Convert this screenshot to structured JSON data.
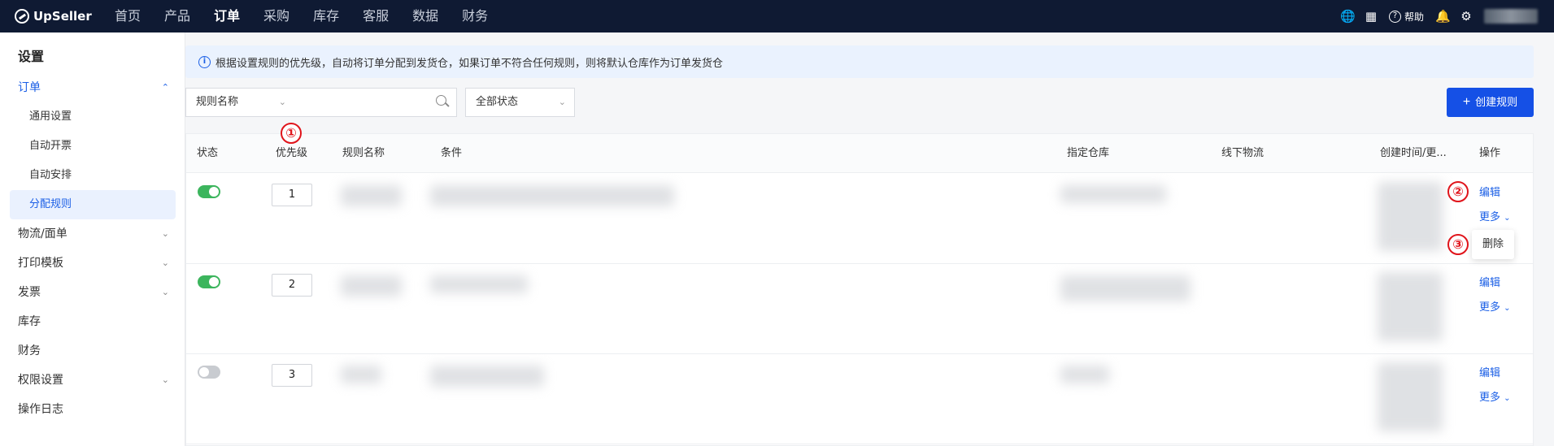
{
  "topbar": {
    "logo": "UpSeller",
    "nav": [
      "首页",
      "产品",
      "订单",
      "采购",
      "库存",
      "客服",
      "数据",
      "财务"
    ],
    "active_nav": "订单",
    "help": "帮助"
  },
  "sidebar": {
    "title": "设置",
    "items": [
      {
        "label": "订单",
        "expanded": true
      },
      {
        "label": "通用设置"
      },
      {
        "label": "自动开票"
      },
      {
        "label": "自动安排"
      },
      {
        "label": "分配规则",
        "selected": true
      },
      {
        "label": "物流/面单"
      },
      {
        "label": "打印模板"
      },
      {
        "label": "发票"
      },
      {
        "label": "库存"
      },
      {
        "label": "财务"
      },
      {
        "label": "权限设置"
      },
      {
        "label": "操作日志"
      }
    ]
  },
  "notice": "根据设置规则的优先级，自动将订单分配到发货仓，如果订单不符合任何规则，则将默认仓库作为订单发货仓",
  "filters": {
    "field_select": "规则名称",
    "search_placeholder": "",
    "status_select": "全部状态",
    "create_button": "创建规则"
  },
  "table": {
    "headers": [
      "状态",
      "优先级",
      "规则名称",
      "条件",
      "指定仓库",
      "线下物流",
      "创建时间/更...",
      "操作"
    ],
    "rows": [
      {
        "enabled": true,
        "priority": "1",
        "edit": "编辑",
        "more": "更多"
      },
      {
        "enabled": true,
        "priority": "2",
        "edit": "编辑",
        "more": "更多"
      },
      {
        "enabled": false,
        "priority": "3",
        "edit": "编辑",
        "more": "更多"
      }
    ]
  },
  "dropdown": {
    "delete": "删除"
  },
  "annotations": [
    "①",
    "②",
    "③"
  ],
  "colors": {
    "accent": "#1550e6",
    "topbar": "#0f1a33",
    "toggle_on": "#3cb55d",
    "annotation": "#e0141b"
  }
}
